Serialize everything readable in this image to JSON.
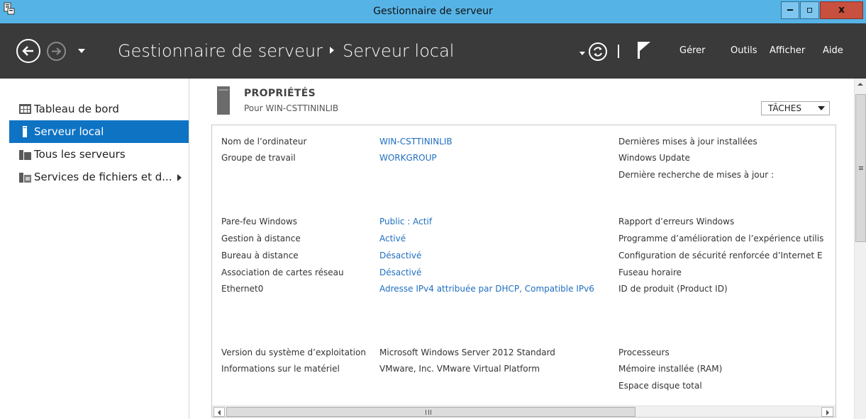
{
  "window": {
    "title": "Gestionnaire de serveur",
    "controls": {
      "minimize": "‒",
      "maximize": "▫",
      "close": "x"
    }
  },
  "header": {
    "breadcrumb_root": "Gestionnaire de serveur",
    "breadcrumb_current": "Serveur local",
    "menu": {
      "manage": "Gérer",
      "tools": "Outils",
      "view": "Afficher",
      "help": "Aide"
    }
  },
  "sidebar": {
    "items": [
      {
        "label": "Tableau de bord",
        "icon": "dashboard-icon"
      },
      {
        "label": "Serveur local",
        "icon": "server-icon",
        "active": true
      },
      {
        "label": "Tous les serveurs",
        "icon": "servers-icon"
      },
      {
        "label": "Services de fichiers et d...",
        "icon": "file-services-icon"
      }
    ]
  },
  "properties": {
    "title": "PROPRIÉTÉS",
    "subtitle": "Pour WIN-CSTTININLIB",
    "tasks_label": "TÂCHES",
    "col1": [
      {
        "label": "Nom de l’ordinateur",
        "value": "WIN-CSTTININLIB"
      },
      {
        "label": "Groupe de travail",
        "value": "WORKGROUP"
      },
      {
        "label": "Pare-feu Windows",
        "value": "Public : Actif"
      },
      {
        "label": "Gestion à distance",
        "value": "Activé"
      },
      {
        "label": "Bureau à distance",
        "value": "Désactivé"
      },
      {
        "label": "Association de cartes réseau",
        "value": "Désactivé"
      },
      {
        "label": "Ethernet0",
        "value": "Adresse IPv4 attribuée par DHCP, Compatible IPv6"
      },
      {
        "label": "Version du système d’exploitation",
        "value": "Microsoft Windows Server 2012 Standard"
      },
      {
        "label": "Informations sur le matériel",
        "value": "VMware, Inc. VMware Virtual Platform"
      }
    ],
    "col2": [
      "Dernières mises à jour installées",
      "Windows Update",
      "Dernière recherche de mises à jour :",
      "Rapport d’erreurs Windows",
      "Programme d’amélioration de l’expérience utilis",
      "Configuration de sécurité renforcée d’Internet E",
      "Fuseau horaire",
      "ID de produit (Product ID)",
      "Processeurs",
      "Mémoire installée (RAM)",
      "Espace disque total"
    ]
  },
  "colors": {
    "titlebar": "#56b3e6",
    "header": "#3a3a3a",
    "accent": "#0f73c4",
    "link": "#1f6fbf",
    "close": "#c7503e"
  }
}
